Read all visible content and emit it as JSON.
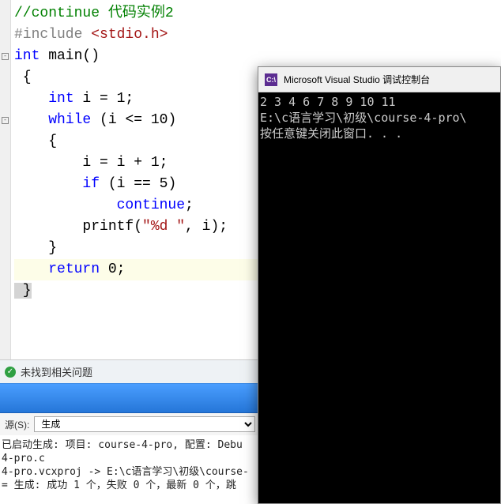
{
  "code": {
    "lines": [
      {
        "tokens": [
          {
            "cls": "c-comment",
            "t": "//continue 代码实例2"
          }
        ]
      },
      {
        "tokens": [
          {
            "cls": "c-preproc",
            "t": "#include "
          },
          {
            "cls": "c-include-file",
            "t": "<stdio.h>"
          }
        ]
      },
      {
        "tokens": [
          {
            "cls": "c-keyword",
            "t": "int"
          },
          {
            "cls": "c-default",
            "t": " main"
          },
          {
            "cls": "c-paren",
            "t": "()"
          }
        ]
      },
      {
        "tokens": [
          {
            "cls": "c-default",
            "t": " {"
          }
        ]
      },
      {
        "tokens": [
          {
            "cls": "c-default",
            "t": "    "
          },
          {
            "cls": "c-keyword",
            "t": "int"
          },
          {
            "cls": "c-default",
            "t": " i = 1;"
          }
        ]
      },
      {
        "tokens": [
          {
            "cls": "c-default",
            "t": "    "
          },
          {
            "cls": "c-keyword",
            "t": "while"
          },
          {
            "cls": "c-default",
            "t": " (i <= 10)"
          }
        ]
      },
      {
        "tokens": [
          {
            "cls": "c-default",
            "t": "    {"
          }
        ]
      },
      {
        "tokens": [
          {
            "cls": "c-default",
            "t": "        i = i + 1;"
          }
        ]
      },
      {
        "tokens": [
          {
            "cls": "c-default",
            "t": "        "
          },
          {
            "cls": "c-keyword",
            "t": "if"
          },
          {
            "cls": "c-default",
            "t": " (i == 5)"
          }
        ]
      },
      {
        "tokens": [
          {
            "cls": "c-default",
            "t": "            "
          },
          {
            "cls": "c-keyword",
            "t": "continue"
          },
          {
            "cls": "c-default",
            "t": ";"
          }
        ]
      },
      {
        "tokens": [
          {
            "cls": "c-default",
            "t": "        printf("
          },
          {
            "cls": "c-string",
            "t": "\"%d \""
          },
          {
            "cls": "c-default",
            "t": ", i);"
          }
        ]
      },
      {
        "tokens": [
          {
            "cls": "c-default",
            "t": "    }"
          }
        ]
      },
      {
        "tokens": [
          {
            "cls": "c-default",
            "t": "    "
          },
          {
            "cls": "c-keyword",
            "t": "return"
          },
          {
            "cls": "c-default",
            "t": " 0;"
          }
        ],
        "caret": true
      },
      {
        "tokens": [
          {
            "cls": "c-default sel-brace",
            "t": " }"
          }
        ]
      }
    ]
  },
  "gutter": {
    "fold_rows": [
      2,
      5
    ]
  },
  "status": {
    "issues_label": "未找到相关问题"
  },
  "output": {
    "source_label": "源(S):",
    "source_value": "生成",
    "lines": [
      "已启动生成: 项目: course-4-pro, 配置: Debu",
      "4-pro.c",
      "4-pro.vcxproj -> E:\\c语言学习\\初级\\course-",
      "= 生成: 成功 1 个，失败 0 个，最新 0 个，跳"
    ]
  },
  "console": {
    "title": "Microsoft Visual Studio 调试控制台",
    "icon_text": "C:\\",
    "lines": [
      "2 3 4 6 7 8 9 10 11",
      "E:\\c语言学习\\初级\\course-4-pro\\",
      "按任意键关闭此窗口. . ."
    ]
  }
}
